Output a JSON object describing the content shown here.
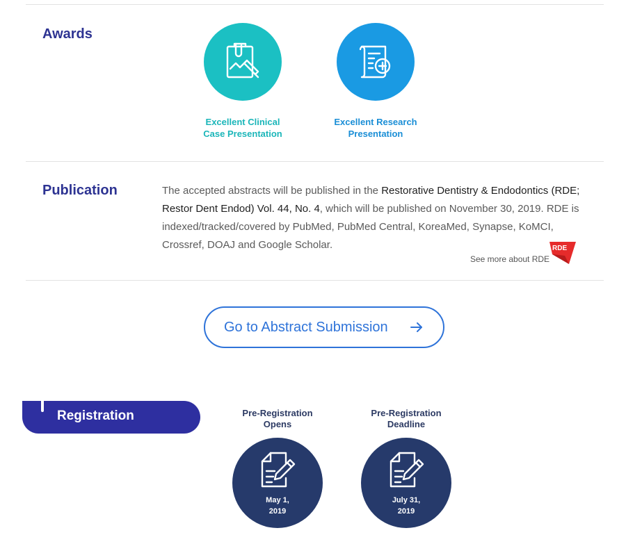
{
  "awards": {
    "title": "Awards",
    "items": [
      {
        "label_line1": "Excellent Clinical",
        "label_line2": "Case Presentation",
        "color": "#1bc0c3",
        "icon": "clinical-case-clipboard-icon"
      },
      {
        "label_line1": "Excellent Research",
        "label_line2": "Presentation",
        "color": "#1a9ae3",
        "icon": "research-scroll-icon"
      }
    ]
  },
  "publication": {
    "title": "Publication",
    "text_part1": "The accepted abstracts will be published in the ",
    "journal": "Restorative Dentistry & Endodontics (RDE; Restor Dent Endod) Vol. 44, No. 4",
    "text_part2": ", which will be published on November 30, 2019. RDE is indexed/tracked/covered by PubMed, PubMed Central, KoreaMed, Synapse, KoMCI, Crossref, DOAJ and Google Scholar.",
    "see_more": "See more about RDE",
    "logo_text": "RDE"
  },
  "cta": {
    "label": "Go to Abstract Submission",
    "color": "#2e73d9"
  },
  "registration": {
    "title": "Registration",
    "dates": [
      {
        "title_line1": "Pre-Registration",
        "title_line2": "Opens",
        "value_line1": "May 1,",
        "value_line2": "2019"
      },
      {
        "title_line1": "Pre-Registration",
        "title_line2": "Deadline",
        "value_line1": "July 31,",
        "value_line2": "2019"
      }
    ]
  }
}
